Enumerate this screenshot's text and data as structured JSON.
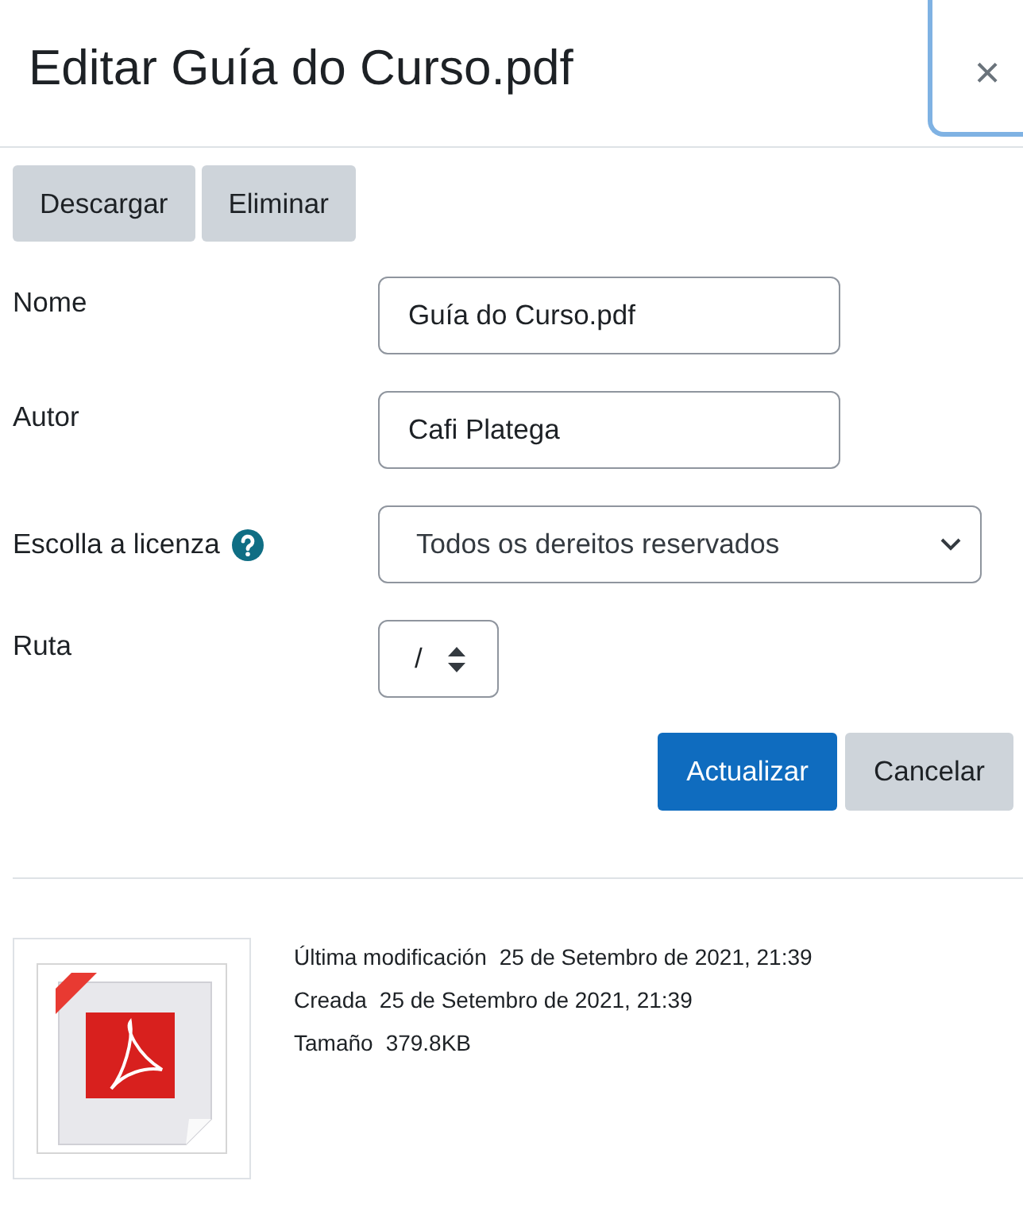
{
  "dialog": {
    "title": "Editar Guía do Curso.pdf",
    "close": "×"
  },
  "actions": [
    {
      "label": "Descargar"
    },
    {
      "label": "Eliminar"
    }
  ],
  "fields": [
    {
      "kind": "text",
      "label": "Nome",
      "value": "Guía do Curso.pdf"
    },
    {
      "kind": "text",
      "label": "Autor",
      "value": "Cafi Platega"
    },
    {
      "kind": "select",
      "label": "Escolla a licenza",
      "help": true,
      "value": "Todos os dereitos reservados"
    },
    {
      "kind": "stepper",
      "label": "Ruta",
      "value": "/"
    }
  ],
  "buttons": [
    {
      "label": "Actualizar",
      "primary": true
    },
    {
      "label": "Cancelar",
      "primary": false
    }
  ],
  "file_info": [
    {
      "label": "Última modificación",
      "value": "25 de Setembro de 2021, 21:39"
    },
    {
      "label": "Creada",
      "value": "25 de Setembro de 2021, 21:39"
    },
    {
      "label": "Tamaño",
      "value": "379.8KB"
    }
  ]
}
